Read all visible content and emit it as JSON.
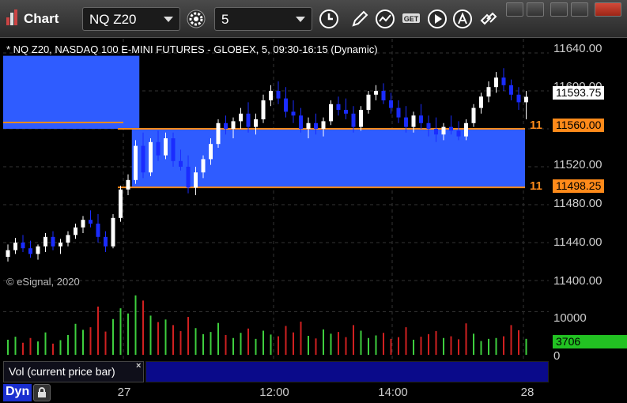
{
  "window": {
    "title": "Chart",
    "symbol": "NQ Z20",
    "interval": "5"
  },
  "chart_info": {
    "symbol_label": "* NQ Z20, NASDAQ 100 E-MINI FUTURES - GLOBEX, 5, 09:30-16:15 (Dynamic)",
    "copyright": "© eSignal, 2020"
  },
  "price_axis": {
    "ticks": [
      "11640.00",
      "11600.00",
      "11520.00",
      "11480.00",
      "11440.00",
      "11400.00"
    ],
    "current_price": "11593.75",
    "upper_level": "11560.00",
    "lower_level": "11498.25",
    "upper_level_side": "11",
    "lower_level_side": "11"
  },
  "volume_axis": {
    "ticks": [
      "10000",
      "0"
    ],
    "current_volume": "3706"
  },
  "volume_legend": "Vol (current price bar)",
  "volume_legend_close": "×",
  "time_axis": {
    "labels": [
      "27",
      "12:00",
      "14:00",
      "28"
    ]
  },
  "bottom": {
    "dyn_label": "Dyn",
    "dyn_icon": "lock-icon"
  },
  "colors": {
    "up_candle": "#ffffff",
    "down_candle": "#1a2cff",
    "zone": "#2f5cff",
    "level_line": "#ff8a1a",
    "vol_up": "#3ecf3e",
    "vol_down": "#d02020",
    "current_price_tag": "#ffffff",
    "level_tag": "#ff8a1a",
    "volume_tag": "#22c222"
  },
  "chart_data": {
    "type": "candlestick",
    "price_range": [
      11390,
      11655
    ],
    "volume_range": [
      0,
      14500
    ],
    "zones": [
      {
        "from_bar": -1,
        "to_bar": 17,
        "low": 11560,
        "high": 11637
      },
      {
        "from_bar": 17,
        "to_bar": 80,
        "low": 11498.25,
        "high": 11560
      }
    ],
    "levels": [
      11560,
      11498.25
    ],
    "candles": [
      [
        11425,
        11438,
        11420,
        11432
      ],
      [
        11432,
        11445,
        11428,
        11440
      ],
      [
        11440,
        11448,
        11430,
        11434
      ],
      [
        11434,
        11442,
        11424,
        11428
      ],
      [
        11428,
        11438,
        11422,
        11436
      ],
      [
        11436,
        11450,
        11430,
        11446
      ],
      [
        11446,
        11452,
        11432,
        11436
      ],
      [
        11436,
        11444,
        11428,
        11440
      ],
      [
        11440,
        11452,
        11436,
        11448
      ],
      [
        11448,
        11460,
        11444,
        11456
      ],
      [
        11456,
        11468,
        11450,
        11464
      ],
      [
        11464,
        11474,
        11456,
        11460
      ],
      [
        11460,
        11470,
        11440,
        11446
      ],
      [
        11446,
        11452,
        11430,
        11436
      ],
      [
        11436,
        11470,
        11434,
        11466
      ],
      [
        11466,
        11500,
        11462,
        11496
      ],
      [
        11496,
        11512,
        11490,
        11506
      ],
      [
        11506,
        11548,
        11502,
        11542
      ],
      [
        11542,
        11556,
        11508,
        11514
      ],
      [
        11514,
        11550,
        11510,
        11546
      ],
      [
        11546,
        11558,
        11526,
        11532
      ],
      [
        11532,
        11556,
        11528,
        11550
      ],
      [
        11550,
        11556,
        11520,
        11526
      ],
      [
        11526,
        11538,
        11516,
        11520
      ],
      [
        11520,
        11532,
        11492,
        11498
      ],
      [
        11498,
        11520,
        11490,
        11514
      ],
      [
        11514,
        11532,
        11508,
        11528
      ],
      [
        11528,
        11550,
        11522,
        11544
      ],
      [
        11544,
        11570,
        11540,
        11566
      ],
      [
        11566,
        11574,
        11554,
        11560
      ],
      [
        11560,
        11572,
        11550,
        11568
      ],
      [
        11568,
        11582,
        11560,
        11576
      ],
      [
        11576,
        11588,
        11556,
        11562
      ],
      [
        11562,
        11576,
        11554,
        11570
      ],
      [
        11570,
        11596,
        11566,
        11590
      ],
      [
        11590,
        11606,
        11584,
        11600
      ],
      [
        11600,
        11610,
        11586,
        11592
      ],
      [
        11592,
        11604,
        11572,
        11578
      ],
      [
        11578,
        11590,
        11566,
        11574
      ],
      [
        11574,
        11582,
        11556,
        11560
      ],
      [
        11560,
        11572,
        11550,
        11566
      ],
      [
        11566,
        11576,
        11554,
        11560
      ],
      [
        11560,
        11572,
        11552,
        11568
      ],
      [
        11568,
        11590,
        11564,
        11586
      ],
      [
        11586,
        11594,
        11574,
        11580
      ],
      [
        11580,
        11592,
        11570,
        11576
      ],
      [
        11576,
        11584,
        11556,
        11562
      ],
      [
        11562,
        11584,
        11558,
        11580
      ],
      [
        11580,
        11600,
        11576,
        11596
      ],
      [
        11596,
        11606,
        11590,
        11600
      ],
      [
        11600,
        11608,
        11586,
        11590
      ],
      [
        11590,
        11598,
        11576,
        11582
      ],
      [
        11582,
        11590,
        11566,
        11572
      ],
      [
        11572,
        11584,
        11556,
        11562
      ],
      [
        11562,
        11578,
        11556,
        11574
      ],
      [
        11574,
        11586,
        11560,
        11566
      ],
      [
        11566,
        11574,
        11552,
        11560
      ],
      [
        11560,
        11572,
        11546,
        11554
      ],
      [
        11554,
        11566,
        11548,
        11562
      ],
      [
        11562,
        11574,
        11554,
        11558
      ],
      [
        11558,
        11568,
        11548,
        11552
      ],
      [
        11552,
        11570,
        11548,
        11566
      ],
      [
        11566,
        11586,
        11562,
        11582
      ],
      [
        11582,
        11598,
        11576,
        11594
      ],
      [
        11594,
        11610,
        11588,
        11604
      ],
      [
        11604,
        11620,
        11598,
        11614
      ],
      [
        11614,
        11624,
        11600,
        11606
      ],
      [
        11606,
        11612,
        11590,
        11596
      ],
      [
        11596,
        11604,
        11580,
        11588
      ],
      [
        11588,
        11600,
        11570,
        11593.75
      ]
    ],
    "volumes": [
      [
        3500,
        1
      ],
      [
        4200,
        1
      ],
      [
        2800,
        0
      ],
      [
        3900,
        0
      ],
      [
        3100,
        1
      ],
      [
        5200,
        1
      ],
      [
        2600,
        0
      ],
      [
        3400,
        1
      ],
      [
        4600,
        1
      ],
      [
        7200,
        1
      ],
      [
        5800,
        1
      ],
      [
        6400,
        0
      ],
      [
        11200,
        0
      ],
      [
        5400,
        0
      ],
      [
        8300,
        1
      ],
      [
        10800,
        1
      ],
      [
        9600,
        1
      ],
      [
        13800,
        1
      ],
      [
        12600,
        0
      ],
      [
        9100,
        1
      ],
      [
        7600,
        0
      ],
      [
        8200,
        1
      ],
      [
        6900,
        0
      ],
      [
        5500,
        0
      ],
      [
        8800,
        0
      ],
      [
        6200,
        1
      ],
      [
        4800,
        1
      ],
      [
        5300,
        1
      ],
      [
        7400,
        1
      ],
      [
        4600,
        0
      ],
      [
        3900,
        1
      ],
      [
        5100,
        1
      ],
      [
        6100,
        0
      ],
      [
        3700,
        1
      ],
      [
        5600,
        1
      ],
      [
        4700,
        1
      ],
      [
        4300,
        0
      ],
      [
        6700,
        0
      ],
      [
        5200,
        0
      ],
      [
        7700,
        0
      ],
      [
        4400,
        1
      ],
      [
        3800,
        0
      ],
      [
        5900,
        1
      ],
      [
        4900,
        1
      ],
      [
        5300,
        0
      ],
      [
        4100,
        0
      ],
      [
        6900,
        0
      ],
      [
        5600,
        1
      ],
      [
        3900,
        1
      ],
      [
        4500,
        1
      ],
      [
        5100,
        0
      ],
      [
        3700,
        0
      ],
      [
        4100,
        0
      ],
      [
        6400,
        0
      ],
      [
        3500,
        1
      ],
      [
        4200,
        0
      ],
      [
        4800,
        0
      ],
      [
        5500,
        0
      ],
      [
        3900,
        1
      ],
      [
        4300,
        0
      ],
      [
        3600,
        0
      ],
      [
        7300,
        0
      ],
      [
        4900,
        1
      ],
      [
        3200,
        1
      ],
      [
        3700,
        1
      ],
      [
        3900,
        1
      ],
      [
        4300,
        0
      ],
      [
        6900,
        0
      ],
      [
        5700,
        0
      ],
      [
        3706,
        1
      ]
    ]
  }
}
